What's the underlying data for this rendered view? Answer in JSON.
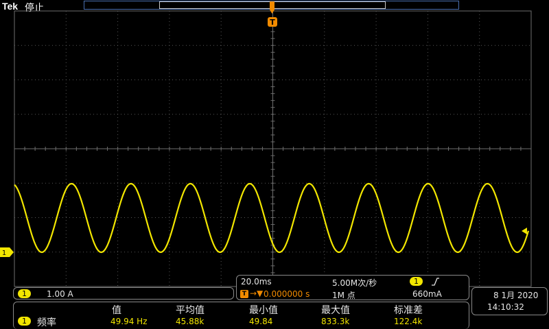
{
  "header": {
    "brand": "Tek",
    "run_status": "停止"
  },
  "trigger_marker": {
    "label": "T"
  },
  "channel1": {
    "badge": "1",
    "scale": "1.00 A",
    "color": "#f2e600"
  },
  "horizontal": {
    "time_per_div": "20.0ms",
    "sample_rate": "5.00M次/秒",
    "trigger_position": "0.000000 s",
    "record_length": "1M 点"
  },
  "trigger": {
    "source_badge": "1",
    "slope_icon": "rising-edge-icon",
    "level": "660mA"
  },
  "datetime": {
    "date": "8 1月 2020",
    "time": "14:10:32"
  },
  "measurements": {
    "headers": [
      "值",
      "平均值",
      "最小值",
      "最大值",
      "标准差"
    ],
    "rows": [
      {
        "badge": "1",
        "name": "频率",
        "values": [
          "49.94 Hz",
          "45.88k",
          "49.84",
          "833.3k",
          "122.4k"
        ]
      }
    ]
  },
  "waveform": {
    "signal": "sine",
    "frequency_hz": 49.94,
    "cycles_visible": 9,
    "color": "#f2e600"
  },
  "colors": {
    "grid": "#6e6e6e",
    "channel1": "#f2e600",
    "trigger": "#f08a00",
    "record_bar": "#4a6fb0"
  }
}
